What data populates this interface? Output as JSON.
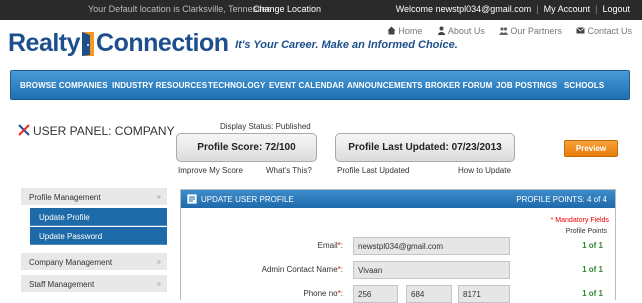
{
  "topbar": {
    "location_text": "Your Default location is Clarksville, Tennessee",
    "change_location": "Change Location",
    "welcome": "Welcome newstpl034@gmail.com",
    "my_account": "My Account",
    "logout": "Logout"
  },
  "header": {
    "logo_word1": "Realty",
    "logo_word2": "Connection",
    "tagline": "It's Your Career. Make an Informed Choice.",
    "nav": [
      {
        "label": "Home",
        "icon": "home-icon"
      },
      {
        "label": "About Us",
        "icon": "people-icon"
      },
      {
        "label": "Our Partners",
        "icon": "partners-icon"
      },
      {
        "label": "Contact Us",
        "icon": "mail-icon"
      }
    ]
  },
  "main_nav": [
    "BROWSE COMPANIES",
    "INDUSTRY RESOURCES",
    "TECHNOLOGY",
    "EVENT CALENDAR",
    "ANNOUNCEMENTS",
    "BROKER FORUM",
    "JOB POSTINGS",
    "SCHOOLS"
  ],
  "panel": {
    "title": "USER PANEL: COMPANY",
    "display_status": "Display Status: Published",
    "profile_score": "Profile Score: 72/100",
    "profile_last_updated": "Profile Last Updated: 07/23/2013",
    "links": [
      "Improve My Score",
      "What's This?",
      "Profile Last Updated",
      "How to Update"
    ],
    "preview": "Preview"
  },
  "sidebar": {
    "items": [
      {
        "label": "Profile Management",
        "arrow": "»"
      },
      {
        "label": "Company Management",
        "arrow": "»"
      },
      {
        "label": "Staff Management",
        "arrow": "»"
      }
    ],
    "subitems": [
      "Update Profile",
      "Update Password"
    ]
  },
  "form": {
    "header_title": "UPDATE USER PROFILE",
    "profile_points": "PROFILE POINTS:  4 of 4",
    "mandatory": "* Mandatory Fields",
    "points_header": "Profile Points",
    "fields": [
      {
        "label": "Email",
        "req": "*",
        "value": "newstpl034@gmail.com",
        "points": "1 of 1"
      },
      {
        "label": "Admin Contact Name",
        "req": "*",
        "value": "Vivaan",
        "points": "1 of 1"
      },
      {
        "label": "Phone no",
        "req": "*",
        "values": [
          "256",
          "684",
          "8171"
        ],
        "points": "1 of 1"
      }
    ]
  },
  "colors": {
    "brand_blue": "#1d4f8c",
    "nav_blue": "#2a7fc1",
    "accent_orange": "#f08a1c",
    "points_green": "#2f8a2f"
  }
}
